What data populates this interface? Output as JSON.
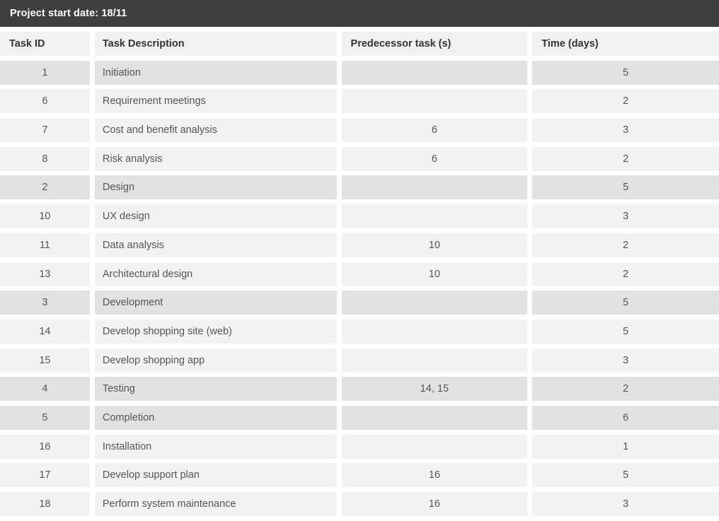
{
  "title_bar": {
    "label": "Project start date: 18/11"
  },
  "table": {
    "columns": [
      {
        "key": "task_id",
        "label": "Task ID"
      },
      {
        "key": "description",
        "label": "Task Description"
      },
      {
        "key": "predecessor",
        "label": "Predecessor task (s)"
      },
      {
        "key": "time",
        "label": "Time (days)"
      }
    ],
    "rows": [
      {
        "task_id": "1",
        "description": "Initiation",
        "predecessor": "",
        "time": "5",
        "summary": true
      },
      {
        "task_id": "6",
        "description": "Requirement meetings",
        "predecessor": "",
        "time": "2",
        "summary": false
      },
      {
        "task_id": "7",
        "description": "Cost and benefit analysis",
        "predecessor": "6",
        "time": "3",
        "summary": false
      },
      {
        "task_id": "8",
        "description": "Risk analysis",
        "predecessor": "6",
        "time": "2",
        "summary": false
      },
      {
        "task_id": "2",
        "description": "Design",
        "predecessor": "",
        "time": "5",
        "summary": true
      },
      {
        "task_id": "10",
        "description": "UX design",
        "predecessor": "",
        "time": "3",
        "summary": false
      },
      {
        "task_id": "11",
        "description": "Data analysis",
        "predecessor": "10",
        "time": "2",
        "summary": false
      },
      {
        "task_id": "13",
        "description": "Architectural design",
        "predecessor": "10",
        "time": "2",
        "summary": false
      },
      {
        "task_id": "3",
        "description": "Development",
        "predecessor": "",
        "time": "5",
        "summary": true
      },
      {
        "task_id": "14",
        "description": "Develop shopping site (web)",
        "predecessor": "",
        "time": "5",
        "summary": false
      },
      {
        "task_id": "15",
        "description": "Develop shopping app",
        "predecessor": "",
        "time": "3",
        "summary": false
      },
      {
        "task_id": "4",
        "description": "Testing",
        "predecessor": "14, 15",
        "time": "2",
        "summary": true
      },
      {
        "task_id": "5",
        "description": "Completion",
        "predecessor": "",
        "time": "6",
        "summary": true
      },
      {
        "task_id": "16",
        "description": "Installation",
        "predecessor": "",
        "time": "1",
        "summary": false
      },
      {
        "task_id": "17",
        "description": "Develop support plan",
        "predecessor": "16",
        "time": "5",
        "summary": false
      },
      {
        "task_id": "18",
        "description": "Perform system maintenance",
        "predecessor": "16",
        "time": "3",
        "summary": false
      }
    ]
  },
  "colors": {
    "title_bar_background": "#3f3f3f",
    "title_bar_text": "#ffffff",
    "header_cell_background": "#f1f1f1",
    "header_cell_text": "#333333",
    "row_background": "#f2f2f2",
    "summary_row_background": "#e2e2e2",
    "body_text": "#555555",
    "page_background": "#ffffff"
  }
}
